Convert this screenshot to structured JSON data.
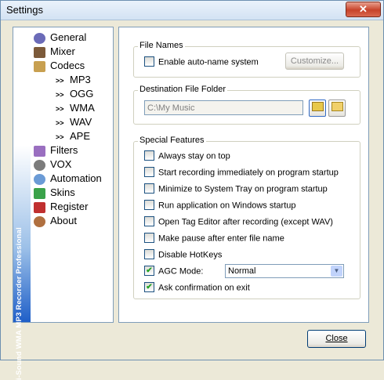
{
  "window": {
    "title": "Settings",
    "close_glyph": "✕"
  },
  "sidebar": {
    "vertical_text": "i-Sound WMA MP3 Recorder Professional",
    "items": [
      {
        "label": "General",
        "icon": "gear-icon",
        "color": "#6b6bb8"
      },
      {
        "label": "Mixer",
        "icon": "mixer-icon",
        "color": "#7c5a3a"
      },
      {
        "label": "Codecs",
        "icon": "codecs-icon",
        "color": "#c8a050"
      },
      {
        "label": "Filters",
        "icon": "filters-icon",
        "color": "#9a6fc0"
      },
      {
        "label": "VOX",
        "icon": "vox-icon",
        "color": "#7c7c7c"
      },
      {
        "label": "Automation",
        "icon": "clock-icon",
        "color": "#6b9bd6"
      },
      {
        "label": "Skins",
        "icon": "skins-icon",
        "color": "#3aa24a"
      },
      {
        "label": "Register",
        "icon": "register-icon",
        "color": "#c03030"
      },
      {
        "label": "About",
        "icon": "about-icon",
        "color": "#b07040"
      }
    ],
    "codecs": [
      {
        "label": "MP3"
      },
      {
        "label": "OGG"
      },
      {
        "label": "WMA"
      },
      {
        "label": "WAV"
      },
      {
        "label": "APE"
      }
    ]
  },
  "file_names": {
    "title": "File Names",
    "auto_name_label": "Enable auto-name system",
    "auto_name_checked": false,
    "customize_label": "Customize..."
  },
  "destination": {
    "title": "Destination File Folder",
    "path_placeholder": "C:\\My Music"
  },
  "features": {
    "title": "Special  Features",
    "options": [
      {
        "label": "Always stay on top",
        "checked": false
      },
      {
        "label": "Start recording immediately on program startup",
        "checked": false
      },
      {
        "label": "Minimize to System Tray on program startup",
        "checked": false
      },
      {
        "label": "Run application on Windows startup",
        "checked": false
      },
      {
        "label": "Open Tag Editor after recording (except WAV)",
        "checked": false
      },
      {
        "label": "Make pause after enter file name",
        "checked": false
      },
      {
        "label": "Disable HotKeys",
        "checked": false
      },
      {
        "label": "AGC Mode:",
        "checked": true
      },
      {
        "label": "Ask confirmation on exit",
        "checked": true
      }
    ],
    "agc_value": "Normal"
  },
  "footer": {
    "close_label": "Close"
  },
  "check_glyph": "✔"
}
